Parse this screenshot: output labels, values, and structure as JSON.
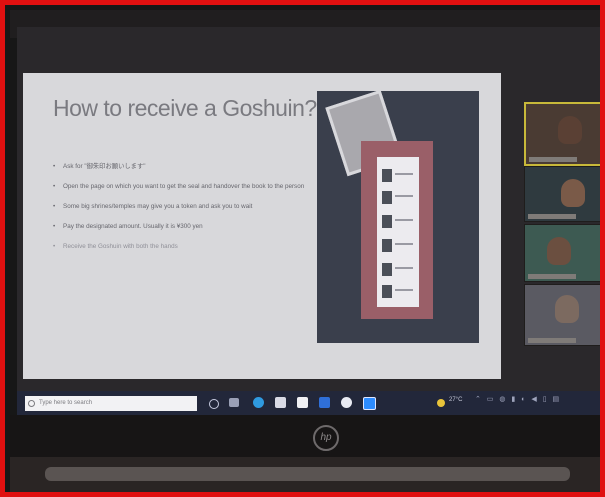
{
  "window": {
    "title": ""
  },
  "slide": {
    "title": "How to receive a Goshuin?",
    "bullets": [
      "Ask for \"御朱印お願いします\"",
      "Open the page on which you want to get the seal and handover the book to the person",
      "Some big shrines/temples may give you a token and ask you to wait",
      "Pay the designated amount. Usually it is ¥300 yen",
      "Receive the Goshuin with both the hands"
    ]
  },
  "taskbar": {
    "search_placeholder": "Type here to search",
    "tray_temp": "27°C",
    "tray_time": "",
    "tray_date": ""
  },
  "laptop": {
    "brand_logo": "hp"
  },
  "colors": {
    "photo_border": "#e01010",
    "slide_bg": "#d8d8db",
    "taskbar": "#22273a"
  }
}
